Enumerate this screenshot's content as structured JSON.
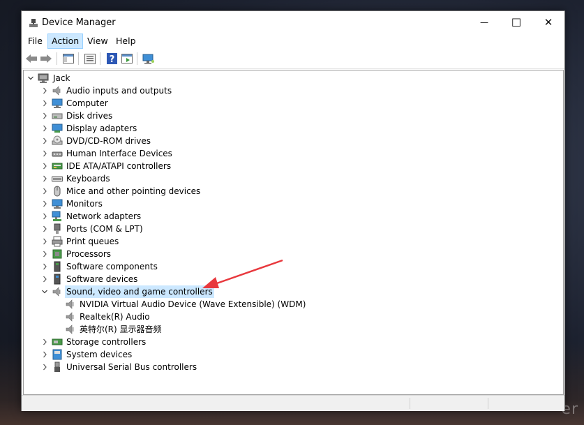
{
  "window": {
    "title": "Device Manager"
  },
  "controls": {
    "minimize": "—",
    "maximize": "☐",
    "close": "✕"
  },
  "menu": [
    {
      "label": "File"
    },
    {
      "label": "Action",
      "active": true
    },
    {
      "label": "View"
    },
    {
      "label": "Help"
    }
  ],
  "toolbar": {
    "buttons": [
      "back-arrow-icon",
      "forward-arrow-icon",
      "show-hide-console-tree-icon",
      "properties-icon",
      "help-icon",
      "run-action-icon",
      "monitor-icon"
    ]
  },
  "tree": {
    "root": "Jack",
    "categories": [
      {
        "label": "Audio inputs and outputs",
        "icon": "speaker-icon"
      },
      {
        "label": "Computer",
        "icon": "computer-icon"
      },
      {
        "label": "Disk drives",
        "icon": "disk-drive-icon"
      },
      {
        "label": "Display adapters",
        "icon": "display-adapter-icon"
      },
      {
        "label": "DVD/CD-ROM drives",
        "icon": "dvd-drive-icon"
      },
      {
        "label": "Human Interface Devices",
        "icon": "hid-icon"
      },
      {
        "label": "IDE ATA/ATAPI controllers",
        "icon": "ide-controller-icon"
      },
      {
        "label": "Keyboards",
        "icon": "keyboard-icon"
      },
      {
        "label": "Mice and other pointing devices",
        "icon": "mouse-icon"
      },
      {
        "label": "Monitors",
        "icon": "monitor-icon"
      },
      {
        "label": "Network adapters",
        "icon": "network-adapter-icon"
      },
      {
        "label": "Ports (COM & LPT)",
        "icon": "port-icon"
      },
      {
        "label": "Print queues",
        "icon": "printer-icon"
      },
      {
        "label": "Processors",
        "icon": "processor-icon"
      },
      {
        "label": "Software components",
        "icon": "software-component-icon"
      },
      {
        "label": "Software devices",
        "icon": "software-device-icon"
      },
      {
        "label": "Sound, video and game controllers",
        "icon": "speaker-icon",
        "expanded": true,
        "selected": true,
        "children": [
          {
            "label": "NVIDIA Virtual Audio Device (Wave Extensible) (WDM)"
          },
          {
            "label": "Realtek(R) Audio"
          },
          {
            "label": "英特尔(R) 显示器音频"
          }
        ]
      },
      {
        "label": "Storage controllers",
        "icon": "storage-controller-icon"
      },
      {
        "label": "System devices",
        "icon": "system-device-icon"
      },
      {
        "label": "Universal Serial Bus controllers",
        "icon": "usb-icon"
      }
    ]
  },
  "annotation": {
    "arrow_color": "#e8383d"
  },
  "colors": {
    "selection": "#cce8ff",
    "accent": "#0078d7"
  }
}
